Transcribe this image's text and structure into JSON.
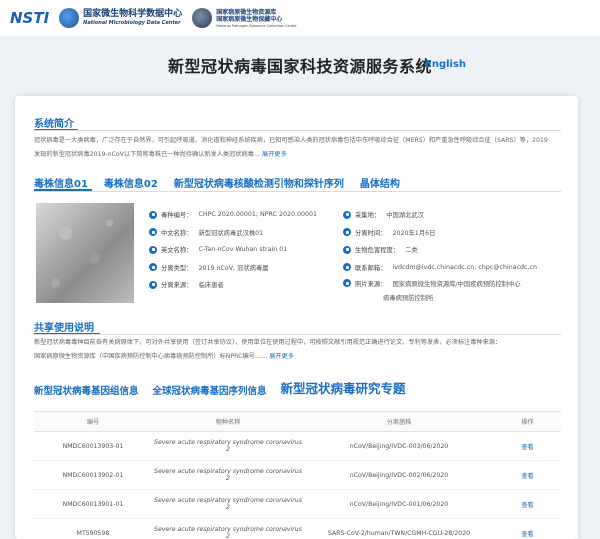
{
  "logos": {
    "nsti": "NSTI",
    "nmdc_main": "国家微生物科学数据中心",
    "nmdc_sub": "National Microbiology Data Center",
    "npmrc_main1": "国家病原微生物资源库",
    "npmrc_main2": "国家病原微生物保藏中心",
    "npmrc_sub": "National Pathogen Resource Collection Center"
  },
  "header": {
    "title": "新型冠状病毒国家科技资源服务系统",
    "lang_link": "English"
  },
  "intro": {
    "title": "系统简介",
    "line1": "冠状病毒是一大类病毒，广泛存在于自然界，可引起呼吸道、消化道和神经系统疾病，已知可感染人类的冠状病毒包括中东呼吸综合征（MERS）和严重急性呼吸综合征（SARS）等，2019",
    "line2": "发现的新型冠状病毒2019-nCoV以下简称毒株已一种尚待确认新发人类冠状病毒",
    "more": "展开更多"
  },
  "tabs": [
    "毒株信息01",
    "毒株信息02",
    "新型冠状病毒核酸检测引物和探针序列",
    "晶体结构"
  ],
  "strain": {
    "left": [
      {
        "label": "毒种编号：",
        "value": "CHPC 2020.00001; NPRC 2020.00001"
      },
      {
        "label": "中文名称：",
        "value": "新型冠状病毒武汉株01"
      },
      {
        "label": "英文名称：",
        "value": "C-Tan-nCov Wuhan strain 01"
      },
      {
        "label": "分离类型：",
        "value": "2019 nCoV, 冠状病毒属"
      },
      {
        "label": "分离来源：",
        "value": "临床患者"
      }
    ],
    "right": [
      {
        "label": "采集地：",
        "value": "中国湖北武汉"
      },
      {
        "label": "分离时间：",
        "value": "2020年1月6日"
      },
      {
        "label": "生物危害程度：",
        "value": "二类"
      },
      {
        "label": "联系邮箱：",
        "value": "ivdcdm@ivdc.chinacdc.cn; chpc@chinacdc.cn"
      },
      {
        "label": "照片来源：",
        "value": "国家病原微生物资源库/中国疾病预防控制中心"
      },
      {
        "label": "",
        "value": "病毒病预防控制所"
      }
    ]
  },
  "share": {
    "title": "共享使用说明",
    "line1": "新型冠状病毒毒种目前各有关病原体下，可对外共享使用（签订共享协议），使用单位在使用过程中，可按照文献引用规范正确进行论文、专利等发表，必须标注毒种来源：",
    "line2": "国家病原微生物资源库（中国疾病预防控制中心病毒病预防控制所）标NPRC编号……",
    "more": "展开更多"
  },
  "links": [
    "新型冠状病毒基因组信息",
    "全球冠状病毒基因序列信息",
    "新型冠状病毒研究专题"
  ],
  "table": {
    "headers": [
      "编号",
      "物种名称",
      "分离菌株",
      "操作"
    ],
    "rows": [
      [
        "NMDC60013903-01",
        "Severe acute respiratory syndrome coronavirus 2",
        "nCoV/Beijing/IVDC-003/06/2020",
        "查看"
      ],
      [
        "NMDC60013902-01",
        "Severe acute respiratory syndrome coronavirus 2",
        "nCoV/Beijing/IVDC-002/06/2020",
        "查看"
      ],
      [
        "NMDC60013901-01",
        "Severe acute respiratory syndrome coronavirus 2",
        "nCoV/Beijing/IVDC-001/06/2020",
        "查看"
      ],
      [
        "MT590598",
        "Severe acute respiratory syndrome coronavirus 2",
        "SARS-CoV-2/human/TWN/CGMH-CGU-28/2020",
        "查看"
      ]
    ]
  },
  "colors": {
    "accent": "#1a6fc4",
    "page_bg": "#eef2f6"
  }
}
